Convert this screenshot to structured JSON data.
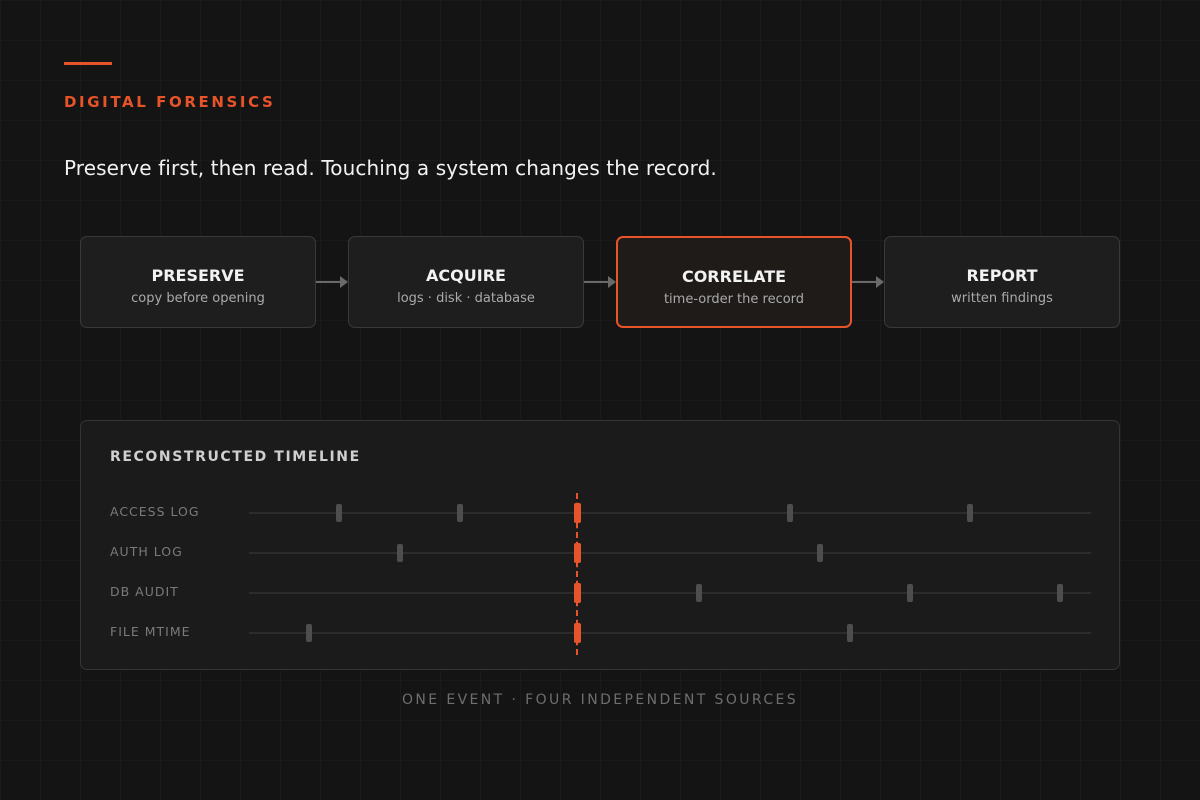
{
  "header": {
    "eyebrow": "DIGITAL FORENSICS",
    "headline": "Preserve first, then read. Touching a system changes the record."
  },
  "colors": {
    "accent": "#e8542a",
    "background": "#141414",
    "card": "#1e1e1e"
  },
  "pipeline": [
    {
      "title": "PRESERVE",
      "subtitle": "copy before opening",
      "active": false
    },
    {
      "title": "ACQUIRE",
      "subtitle": "logs · disk · database",
      "active": false
    },
    {
      "title": "CORRELATE",
      "subtitle": "time-order the record",
      "active": true
    },
    {
      "title": "REPORT",
      "subtitle": "written findings",
      "active": false
    }
  ],
  "timeline": {
    "title": "RECONSTRUCTED TIMELINE",
    "event_time": 0.39,
    "rows": [
      {
        "label": "ACCESS LOG",
        "marks": [
          0.107,
          0.25,
          0.39,
          0.642,
          0.856
        ]
      },
      {
        "label": "AUTH LOG",
        "marks": [
          0.179,
          0.39,
          0.678
        ]
      },
      {
        "label": "DB AUDIT",
        "marks": [
          0.39,
          0.535,
          0.785,
          0.963
        ]
      },
      {
        "label": "FILE MTIME",
        "marks": [
          0.071,
          0.39,
          0.714
        ]
      }
    ]
  },
  "caption": "ONE EVENT · FOUR INDEPENDENT SOURCES"
}
